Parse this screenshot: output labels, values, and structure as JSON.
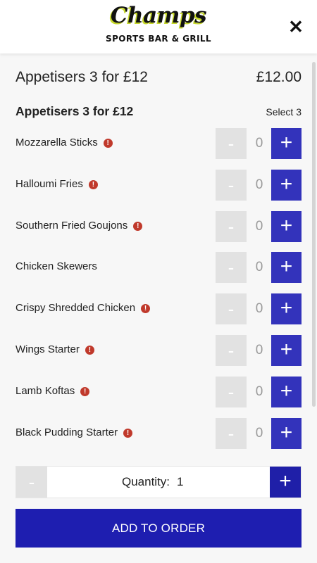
{
  "header": {
    "logo_script": "Champs",
    "logo_sub": "SPORTS BAR & GRILL",
    "close_icon": "close-icon",
    "close_glyph": "✕"
  },
  "deal": {
    "title": "Appetisers 3 for £12",
    "price": "£12.00"
  },
  "group": {
    "title": "Appetisers 3 for £12",
    "subtitle": "Select 3"
  },
  "items": [
    {
      "label": "Mozzarella Sticks",
      "has_info": true,
      "count": "0"
    },
    {
      "label": "Halloumi Fries",
      "has_info": true,
      "count": "0"
    },
    {
      "label": "Southern Fried Goujons",
      "has_info": true,
      "count": "0"
    },
    {
      "label": "Chicken Skewers",
      "has_info": false,
      "count": "0"
    },
    {
      "label": "Crispy Shredded Chicken",
      "has_info": true,
      "count": "0"
    },
    {
      "label": "Wings Starter",
      "has_info": true,
      "count": "0"
    },
    {
      "label": "Lamb Koftas",
      "has_info": true,
      "count": "0"
    },
    {
      "label": "Black Pudding Starter",
      "has_info": true,
      "count": "0"
    }
  ],
  "stepper": {
    "minus": "-",
    "plus": "+",
    "info_glyph": "!"
  },
  "quantity": {
    "label": "Quantity:",
    "value": "1"
  },
  "actions": {
    "add_to_order": "ADD TO ORDER"
  },
  "colors": {
    "accent": "#1e1eb0",
    "plus_button": "#3333bb",
    "disabled": "#e2e2e2",
    "info_icon": "#c0392b",
    "logo_highlight": "#c6d82b"
  }
}
